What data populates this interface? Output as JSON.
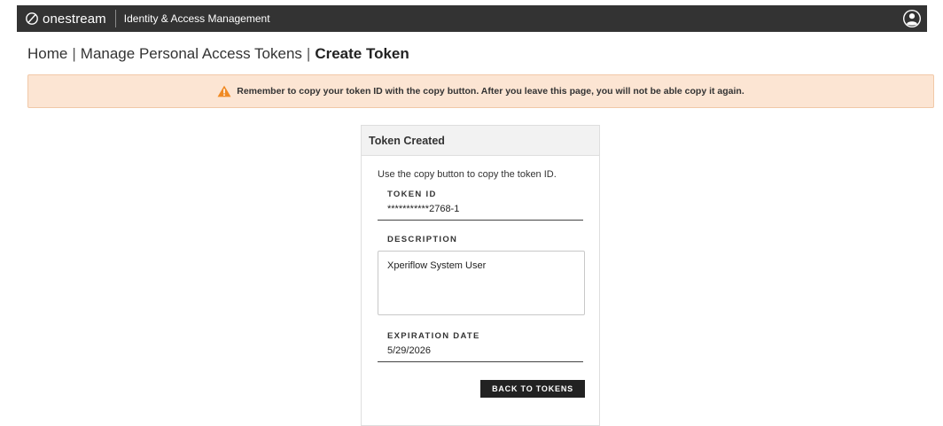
{
  "topbar": {
    "brand": "onestream",
    "app_title": "Identity & Access Management",
    "user_icon": "user-circle-icon"
  },
  "breadcrumb": {
    "items": [
      "Home",
      "Manage Personal Access Tokens"
    ],
    "separator": "|",
    "current": "Create Token"
  },
  "warning": {
    "icon": "warning-triangle-icon",
    "color": "#f08a24",
    "text": "Remember to copy your token ID with the copy button. After you leave this page, you will not be able copy it again."
  },
  "card": {
    "title": "Token Created",
    "instruction": "Use the copy button to copy the token ID.",
    "token_id": {
      "label": "TOKEN ID",
      "value": "***********2768-1"
    },
    "description": {
      "label": "DESCRIPTION",
      "value": "Xperiflow System User"
    },
    "expiration": {
      "label": "EXPIRATION DATE",
      "value": "5/29/2026"
    },
    "back_button": "BACK TO TOKENS"
  },
  "colors": {
    "topbar": "#333333",
    "warning_bg": "#fce5d3",
    "button_bg": "#222222"
  }
}
